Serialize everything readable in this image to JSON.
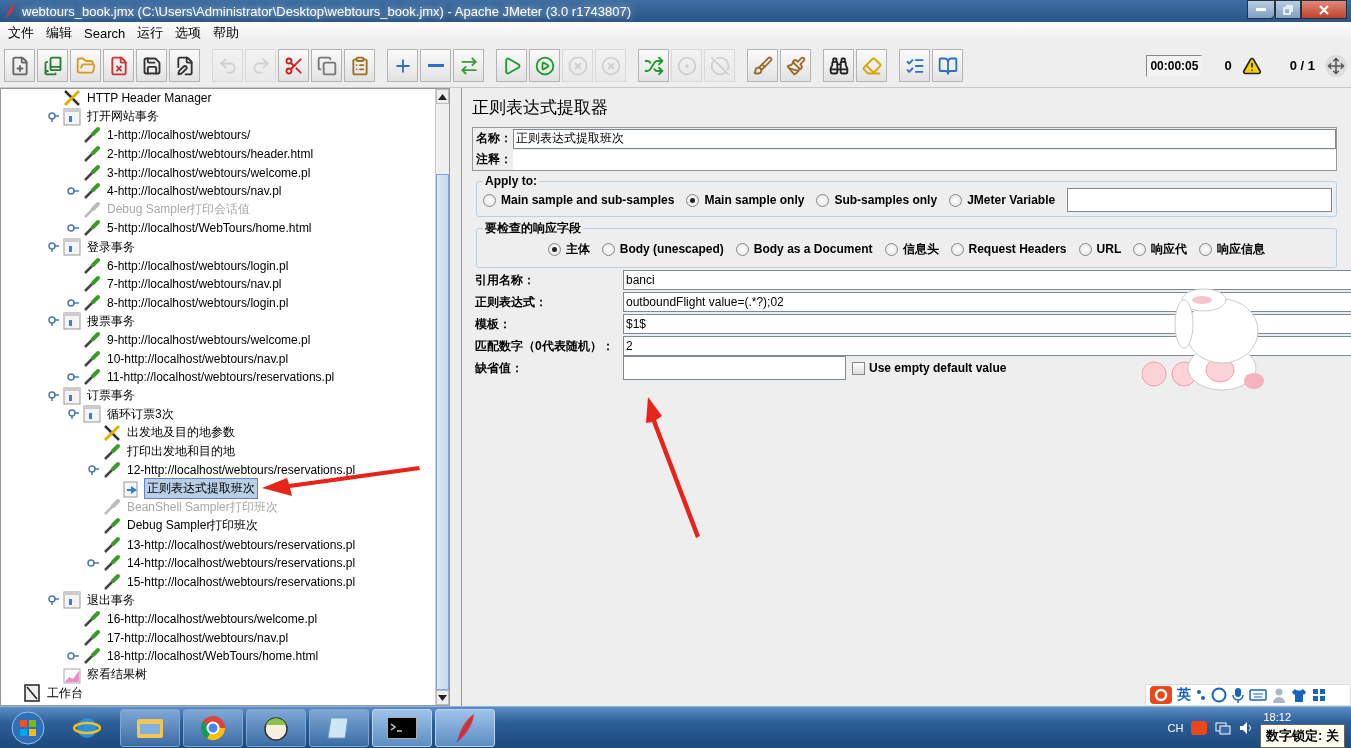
{
  "window": {
    "title": "webtours_book.jmx (C:\\Users\\Administrator\\Desktop\\webtours_book.jmx) - Apache JMeter (3.0 r1743807)"
  },
  "menu": [
    "文件",
    "编辑",
    "Search",
    "运行",
    "选项",
    "帮助"
  ],
  "toolbar": [
    {
      "kind": "new",
      "disabled": false
    },
    {
      "kind": "templates",
      "disabled": false
    },
    {
      "kind": "open",
      "disabled": false
    },
    {
      "kind": "close",
      "disabled": false
    },
    {
      "kind": "save",
      "disabled": false
    },
    {
      "kind": "saveas",
      "disabled": false
    },
    {
      "kind": "undo",
      "disabled": true
    },
    {
      "kind": "redo",
      "disabled": true
    },
    {
      "kind": "cut",
      "disabled": false
    },
    {
      "kind": "copy",
      "disabled": false
    },
    {
      "kind": "paste",
      "disabled": false
    },
    {
      "kind": "expand",
      "disabled": false
    },
    {
      "kind": "collapse",
      "disabled": false
    },
    {
      "kind": "toggle",
      "disabled": false
    },
    {
      "kind": "start",
      "disabled": false
    },
    {
      "kind": "start_nopause",
      "disabled": false
    },
    {
      "kind": "stop",
      "disabled": true
    },
    {
      "kind": "shutdown",
      "disabled": true
    },
    {
      "kind": "remote_start",
      "disabled": false
    },
    {
      "kind": "remote_stop",
      "disabled": true
    },
    {
      "kind": "remote_exit",
      "disabled": true
    },
    {
      "kind": "clear",
      "disabled": false
    },
    {
      "kind": "clear_all",
      "disabled": false
    },
    {
      "kind": "search",
      "disabled": false
    },
    {
      "kind": "reset",
      "disabled": false
    },
    {
      "kind": "functions",
      "disabled": false
    },
    {
      "kind": "help",
      "disabled": false
    }
  ],
  "status": {
    "timer": "00:00:05",
    "errors": "0",
    "threads": "0 / 1"
  },
  "tree": {
    "items": [
      {
        "kind": "config",
        "label": "HTTP Header Manager",
        "selected": false,
        "disabled": false
      },
      {
        "kind": "transaction",
        "label": "打开网站事务",
        "selected": false,
        "disabled": false,
        "expanded": true,
        "children": [
          {
            "kind": "sampler",
            "label": "1-http://localhost/webtours/",
            "selected": false,
            "disabled": false
          },
          {
            "kind": "sampler",
            "label": "2-http://localhost/webtours/header.html",
            "selected": false,
            "disabled": false
          },
          {
            "kind": "sampler",
            "label": "3-http://localhost/webtours/welcome.pl",
            "selected": false,
            "disabled": false
          },
          {
            "kind": "sampler",
            "label": "4-http://localhost/webtours/nav.pl",
            "selected": false,
            "disabled": false,
            "expanded": false
          },
          {
            "kind": "sampler",
            "label": "Debug Sampler打印会话值",
            "selected": false,
            "disabled": true
          },
          {
            "kind": "sampler",
            "label": "5-http://localhost/WebTours/home.html",
            "selected": false,
            "disabled": false,
            "expanded": false
          }
        ]
      },
      {
        "kind": "transaction",
        "label": "登录事务",
        "selected": false,
        "disabled": false,
        "expanded": true,
        "children": [
          {
            "kind": "sampler",
            "label": "6-http://localhost/webtours/login.pl",
            "selected": false,
            "disabled": false
          },
          {
            "kind": "sampler",
            "label": "7-http://localhost/webtours/nav.pl",
            "selected": false,
            "disabled": false
          },
          {
            "kind": "sampler",
            "label": "8-http://localhost/webtours/login.pl",
            "selected": false,
            "disabled": false,
            "expanded": false
          }
        ]
      },
      {
        "kind": "transaction",
        "label": "搜票事务",
        "selected": false,
        "disabled": false,
        "expanded": true,
        "children": [
          {
            "kind": "sampler",
            "label": "9-http://localhost/webtours/welcome.pl",
            "selected": false,
            "disabled": false
          },
          {
            "kind": "sampler",
            "label": "10-http://localhost/webtours/nav.pl",
            "selected": false,
            "disabled": false
          },
          {
            "kind": "sampler",
            "label": "11-http://localhost/webtours/reservations.pl",
            "selected": false,
            "disabled": false,
            "expanded": false
          }
        ]
      },
      {
        "kind": "transaction",
        "label": "订票事务",
        "selected": false,
        "disabled": false,
        "expanded": true,
        "children": [
          {
            "kind": "transaction",
            "label": "循环订票3次",
            "selected": false,
            "disabled": false,
            "expanded": true,
            "children": [
              {
                "kind": "config",
                "label": "出发地及目的地参数",
                "selected": false,
                "disabled": false
              },
              {
                "kind": "sampler",
                "label": "打印出发地和目的地",
                "selected": false,
                "disabled": false
              },
              {
                "kind": "sampler",
                "label": "12-http://localhost/webtours/reservations.pl",
                "selected": false,
                "disabled": false,
                "expanded": true,
                "children": [
                  {
                    "kind": "extractor",
                    "label": "正则表达式提取班次",
                    "selected": true,
                    "disabled": false
                  }
                ]
              },
              {
                "kind": "sampler",
                "label": "BeanShell Sampler打印班次",
                "selected": false,
                "disabled": true
              },
              {
                "kind": "sampler",
                "label": "Debug Sampler打印班次",
                "selected": false,
                "disabled": false
              },
              {
                "kind": "sampler",
                "label": "13-http://localhost/webtours/reservations.pl",
                "selected": false,
                "disabled": false
              },
              {
                "kind": "sampler",
                "label": "14-http://localhost/webtours/reservations.pl",
                "selected": false,
                "disabled": false,
                "expanded": false
              },
              {
                "kind": "sampler",
                "label": "15-http://localhost/webtours/reservations.pl",
                "selected": false,
                "disabled": false
              }
            ]
          }
        ]
      },
      {
        "kind": "transaction",
        "label": "退出事务",
        "selected": false,
        "disabled": false,
        "expanded": true,
        "children": [
          {
            "kind": "sampler",
            "label": "16-http://localhost/webtours/welcome.pl",
            "selected": false,
            "disabled": false
          },
          {
            "kind": "sampler",
            "label": "17-http://localhost/webtours/nav.pl",
            "selected": false,
            "disabled": false
          },
          {
            "kind": "sampler",
            "label": "18-http://localhost/WebTours/home.html",
            "selected": false,
            "disabled": false,
            "expanded": false
          }
        ]
      },
      {
        "kind": "listener",
        "label": "察看结果树",
        "selected": false,
        "disabled": false
      }
    ],
    "workbench": {
      "kind": "workbench",
      "label": "工作台",
      "selected": false,
      "disabled": false
    }
  },
  "editor": {
    "title": "正则表达式提取器",
    "name_label": "名称：",
    "name_value": "正则表达式提取班次",
    "comment_label": "注释：",
    "apply_to": {
      "legend": "Apply to:",
      "options": [
        {
          "label": "Main sample and sub-samples",
          "selected": false
        },
        {
          "label": "Main sample only",
          "selected": true
        },
        {
          "label": "Sub-samples only",
          "selected": false
        },
        {
          "label": "JMeter Variable",
          "selected": false
        }
      ]
    },
    "response_field": {
      "legend": "要检查的响应字段",
      "options": [
        {
          "label": "主体",
          "selected": true
        },
        {
          "label": "Body (unescaped)",
          "selected": false
        },
        {
          "label": "Body as a Document",
          "selected": false
        },
        {
          "label": "信息头",
          "selected": false
        },
        {
          "label": "Request Headers",
          "selected": false
        },
        {
          "label": "URL",
          "selected": false
        },
        {
          "label": "响应代",
          "selected": false
        },
        {
          "label": "响应信息",
          "selected": false
        }
      ]
    },
    "fields": [
      {
        "label": "引用名称：",
        "value": "banci"
      },
      {
        "label": "正则表达式：",
        "value": "outboundFlight value=(.*?);02"
      },
      {
        "label": "模板：",
        "value": "$1$"
      },
      {
        "label": "匹配数字（0代表随机）：",
        "value": "2"
      }
    ],
    "default": {
      "label": "缺省值：",
      "checkbox_label": "Use empty default value",
      "checked": false
    }
  },
  "ime": {
    "mode": "英"
  },
  "taskbar": {
    "lang": "CH",
    "time": "18:12",
    "tooltip": "数字锁定: 关"
  }
}
